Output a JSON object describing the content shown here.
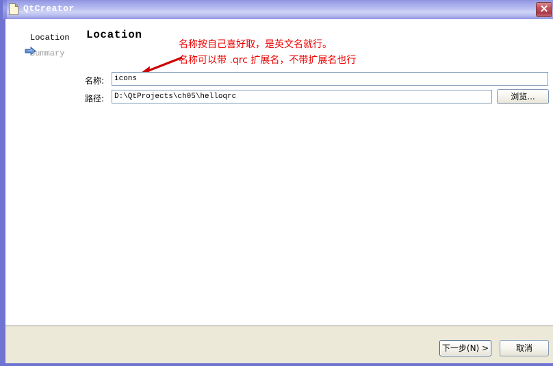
{
  "window": {
    "title": "QtCreator",
    "title_icon": "document-icon",
    "close_icon": "close-icon",
    "border_color": "#6f74d2",
    "titlebar_accent": "#b6bbf0",
    "footer_color": "#ece9d8"
  },
  "sidebar": {
    "items": [
      {
        "label": "Location",
        "state": "current",
        "icon": "blue-arrow-icon"
      },
      {
        "label": "Summary",
        "state": "disabled",
        "icon": ""
      }
    ]
  },
  "main": {
    "page_title": "Location",
    "fields": [
      {
        "label": "名称:",
        "value": "icons",
        "placeholder": ""
      },
      {
        "label": "路径:",
        "value": "D:\\QtProjects\\ch05\\helloqrc",
        "placeholder": ""
      }
    ],
    "browse_label": "浏览..."
  },
  "annotations": {
    "color": "#ee0000",
    "lines": [
      "名称按自己喜好取，是英文名就行。",
      "名称可以带 .qrc 扩展名，不带扩展名也行"
    ],
    "arrow": "red-arrow-icon"
  },
  "footer": {
    "next_label": "下一步(N) >",
    "cancel_label": "取消"
  }
}
